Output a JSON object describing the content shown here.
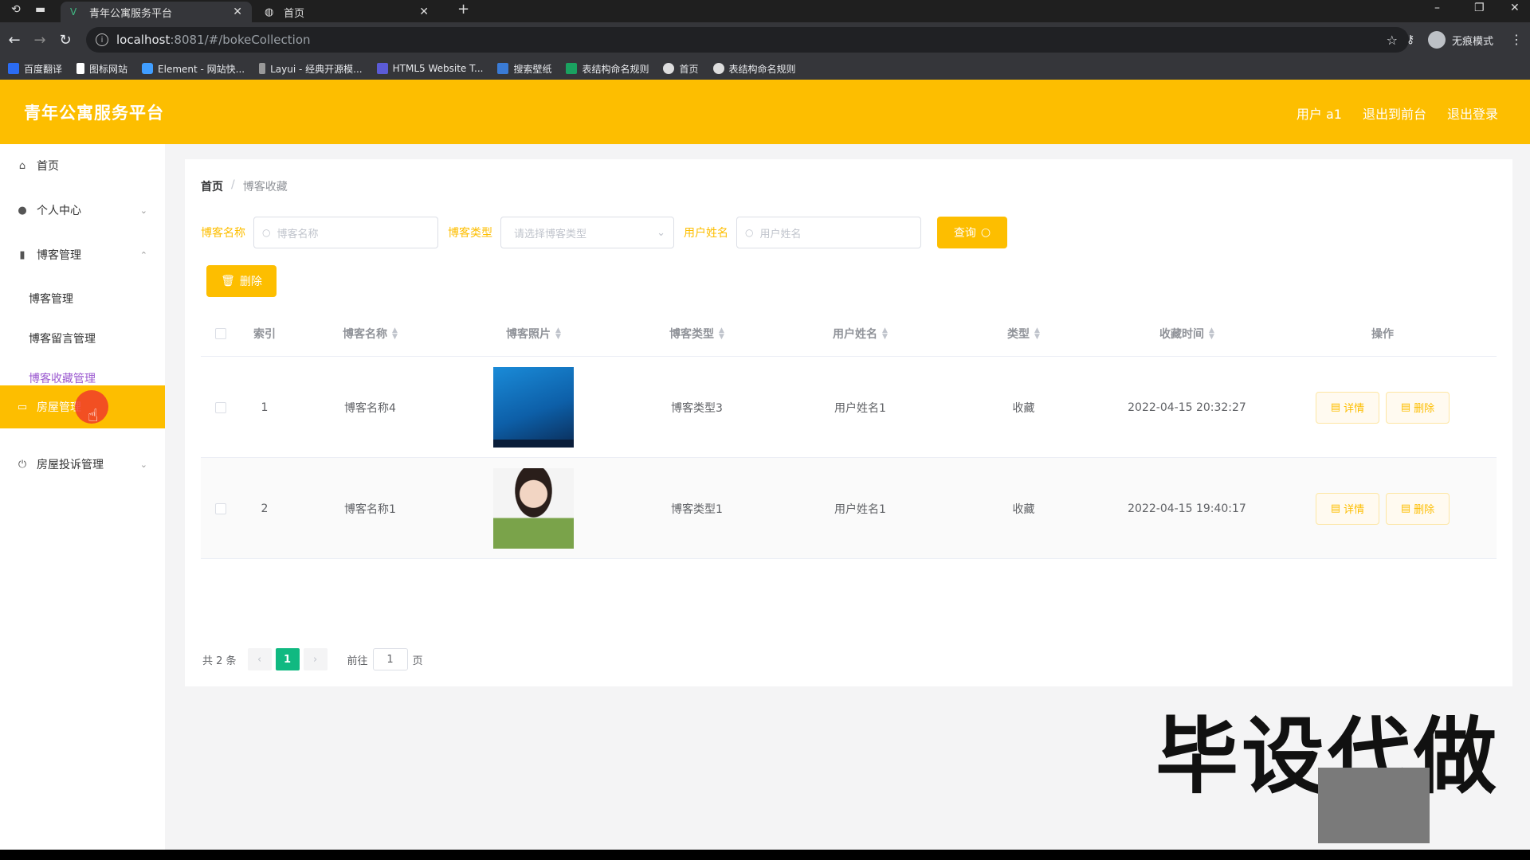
{
  "browser": {
    "tabs": [
      {
        "title": "青年公寓服务平台",
        "active": true
      },
      {
        "title": "首页",
        "active": false
      }
    ],
    "url_host": "localhost",
    "url_path": ":8081/#/bokeCollection",
    "profile_label": "无痕模式",
    "bookmarks": [
      "百度翻译",
      "图标网站",
      "Element - 网站快...",
      "Layui - 经典开源模...",
      "HTML5 Website T...",
      "搜索壁纸",
      "表结构命名规则",
      "首页",
      "表结构命名规则"
    ],
    "icons": {
      "back": "back-arrow-icon",
      "forward": "forward-arrow-icon",
      "reload": "reload-icon",
      "star": "star-icon",
      "key": "key-icon",
      "menu": "more-vert-icon"
    }
  },
  "header": {
    "title": "青年公寓服务平台",
    "links": [
      "用户 a1",
      "退出到前台",
      "退出登录"
    ]
  },
  "sidebar": {
    "items": [
      {
        "label": "首页",
        "icon": "home-icon"
      },
      {
        "label": "个人中心",
        "icon": "user-icon"
      },
      {
        "label": "博客管理",
        "icon": "chart-icon"
      },
      {
        "label": "房屋管理",
        "icon": "house-icon"
      },
      {
        "label": "房屋投诉管理",
        "icon": "power-icon"
      }
    ],
    "sub_items": [
      "博客管理",
      "博客留言管理",
      "博客收藏管理"
    ]
  },
  "breadcrumb": {
    "home": "首页",
    "separator": "/",
    "current": "博客收藏"
  },
  "filters": {
    "name_label": "博客名称",
    "name_placeholder": "博客名称",
    "type_label": "博客类型",
    "type_placeholder": "请选择博客类型",
    "user_label": "用户姓名",
    "user_placeholder": "用户姓名",
    "query_label": "查询"
  },
  "delete_button": "删除",
  "table": {
    "columns": [
      "索引",
      "博客名称",
      "博客照片",
      "博客类型",
      "用户姓名",
      "类型",
      "收藏时间",
      "操作"
    ],
    "rows": [
      {
        "index": "1",
        "name": "博客名称4",
        "photo": "blue-screenshot",
        "type": "博客类型3",
        "user": "用户姓名1",
        "kind": "收藏",
        "time": "2022-04-15 20:32:27"
      },
      {
        "index": "2",
        "name": "博客名称1",
        "photo": "girl-portrait",
        "type": "博客类型1",
        "user": "用户姓名1",
        "kind": "收藏",
        "time": "2022-04-15 19:40:17"
      }
    ],
    "detail_label": "详情",
    "delete_label": "删除"
  },
  "pagination": {
    "total": "共 2 条",
    "current_page": "1",
    "goto_prefix": "前往",
    "goto_value": "1",
    "goto_suffix": "页"
  },
  "watermark": "毕设代做",
  "colors": {
    "accent": "#fdbe00",
    "active_submenu": "#9b59d0",
    "page_active": "#10b981"
  }
}
